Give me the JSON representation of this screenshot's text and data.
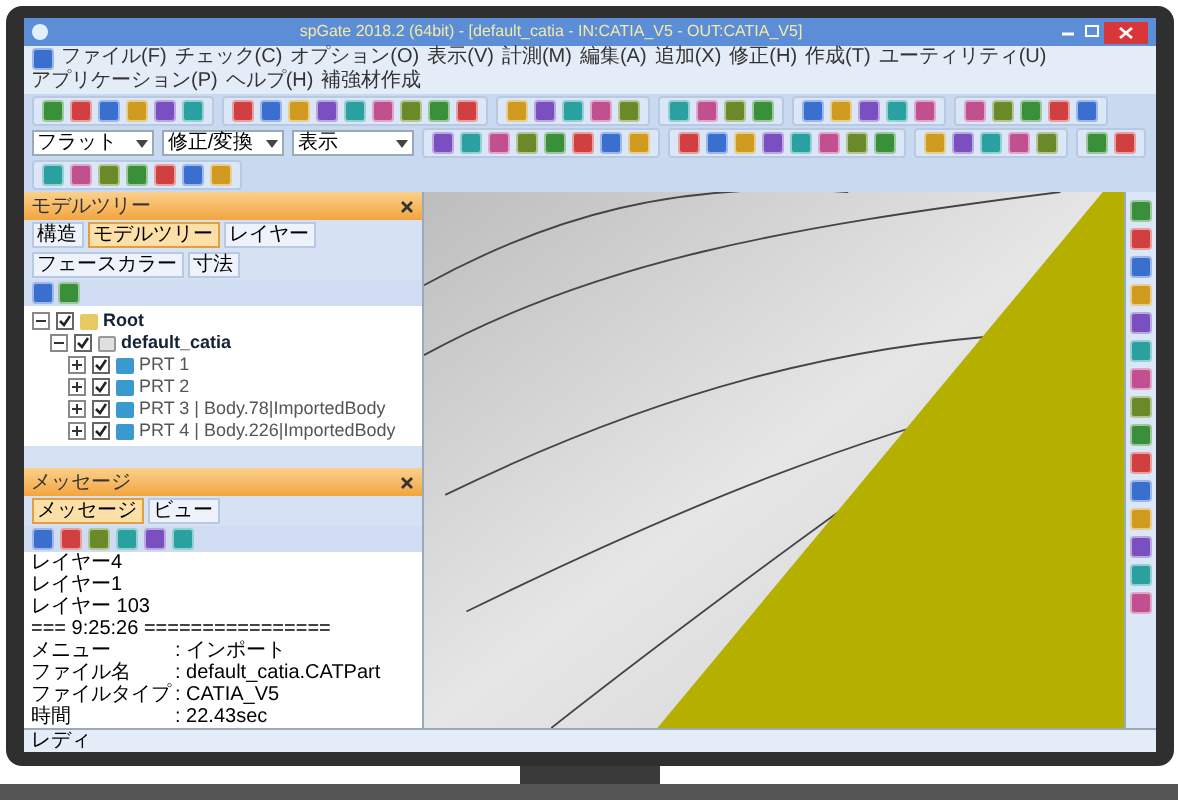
{
  "window": {
    "title": "spGate 2018.2 (64bit) - [default_catia - IN:CATIA_V5 - OUT:CATIA_V5]"
  },
  "menu": [
    "ファイル(F)",
    "チェック(C)",
    "オプション(O)",
    "表示(V)",
    "計測(M)",
    "編集(A)",
    "追加(X)",
    "修正(H)",
    "作成(T)",
    "ユーティリティ(U)",
    "アプリケーション(P)",
    "ヘルプ(H)",
    "補強材作成"
  ],
  "combos": [
    {
      "value": "フラット"
    },
    {
      "value": "修正/変換"
    },
    {
      "value": "表示"
    }
  ],
  "model_tree": {
    "title": "モデルツリー",
    "tabs": [
      {
        "label": "構造",
        "selected": false
      },
      {
        "label": "モデルツリー",
        "selected": true
      },
      {
        "label": "レイヤー",
        "selected": false
      },
      {
        "label": "フェースカラー",
        "selected": false
      },
      {
        "label": "寸法",
        "selected": false
      }
    ],
    "items": [
      {
        "label": "Root",
        "checked": true,
        "expanded": true,
        "children": [
          {
            "label": "default_catia",
            "checked": true,
            "expanded": true,
            "children": [
              {
                "label": "PRT 1",
                "checked": true,
                "expanded": false
              },
              {
                "label": "PRT 2",
                "checked": true,
                "expanded": false
              },
              {
                "label": "PRT 3 | Body.78|ImportedBody",
                "checked": true,
                "expanded": false
              },
              {
                "label": "PRT 4 | Body.226|ImportedBody",
                "checked": true,
                "expanded": false
              }
            ]
          }
        ]
      }
    ]
  },
  "messages": {
    "title": "メッセージ",
    "tabs": [
      {
        "label": "メッセージ",
        "selected": true
      },
      {
        "label": "ビュー",
        "selected": false
      }
    ],
    "lines": [
      "レイヤー4",
      "レイヤー1",
      "レイヤー 103",
      "=== 9:25:26 ================"
    ],
    "fields": [
      {
        "label": "メニュー",
        "value": ": インポート"
      },
      {
        "label": "ファイル名",
        "value": ": default_catia.CATPart"
      },
      {
        "label": "ファイルタイプ",
        "value": ": CATIA_V5"
      },
      {
        "label": "時間",
        "value": ": 22.43sec"
      }
    ]
  },
  "status_bar": "レディ"
}
